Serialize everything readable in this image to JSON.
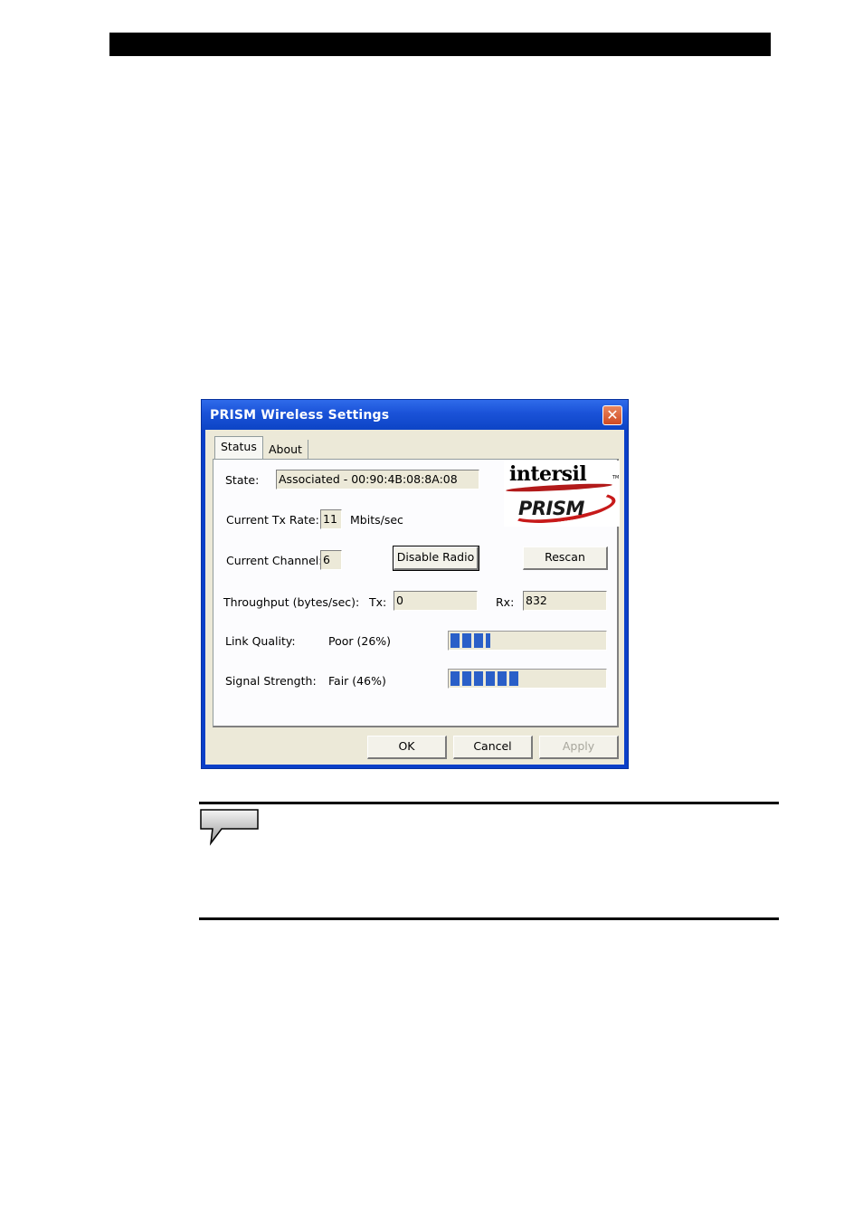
{
  "dialog": {
    "title": "PRISM Wireless Settings",
    "close_glyph": "✕",
    "tabs": [
      {
        "label": "Status",
        "active": true
      },
      {
        "label": "About",
        "active": false
      }
    ],
    "logo": {
      "brand": "intersil",
      "tm": "TM",
      "product": "PRISM"
    },
    "state": {
      "label": "State:",
      "value": "Associated - 00:90:4B:08:8A:08"
    },
    "tx_rate": {
      "label": "Current Tx Rate:",
      "value": "11",
      "unit": "Mbits/sec"
    },
    "channel": {
      "label": "Current Channel:",
      "value": "6"
    },
    "buttons": {
      "disable_radio": "Disable Radio",
      "rescan": "Rescan",
      "ok": "OK",
      "cancel": "Cancel",
      "apply": "Apply"
    },
    "throughput": {
      "label": "Throughput (bytes/sec):",
      "tx_label": "Tx:",
      "tx_value": "0",
      "rx_label": "Rx:",
      "rx_value": "832"
    },
    "link_quality": {
      "label": "Link Quality:",
      "text": "Poor (26%)",
      "percent": 26
    },
    "signal_strength": {
      "label": "Signal Strength:",
      "text": "Fair (46%)",
      "percent": 46
    },
    "colors": {
      "title_bar": "#1a52d8",
      "meter": "#2a5fc8",
      "close": "#cf4a22"
    }
  },
  "note": {
    "icon": "speech-bubble-icon"
  }
}
